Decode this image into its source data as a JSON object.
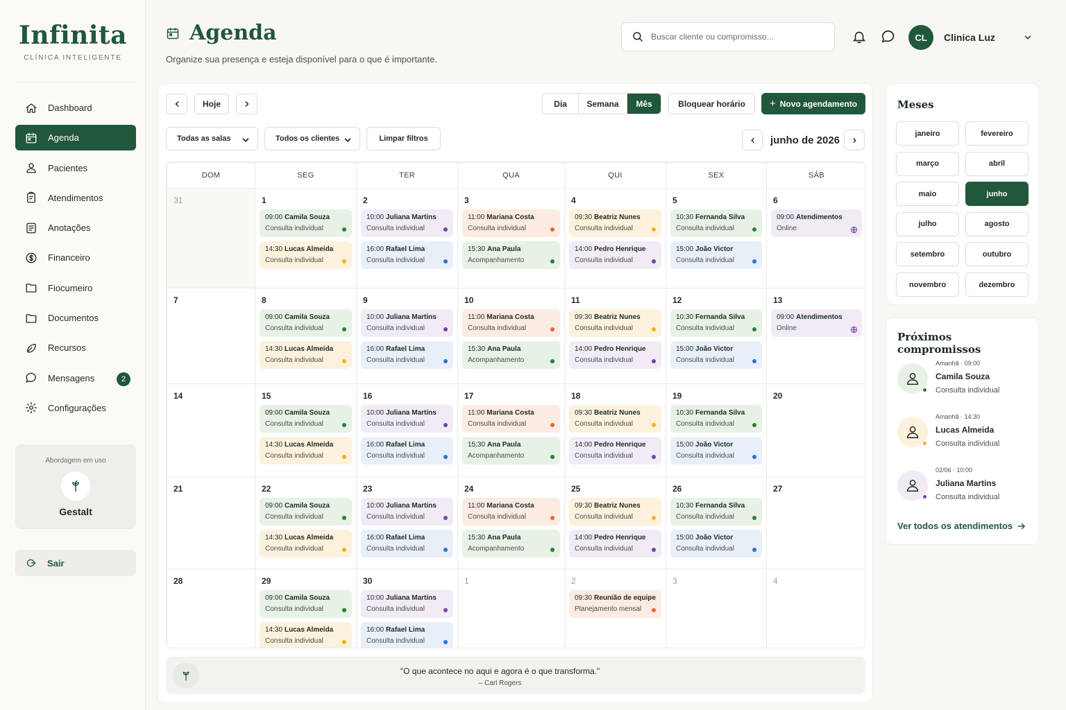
{
  "brand": {
    "name": "Infinita",
    "tagline": "CLÍNICA INTELIGENTE"
  },
  "nav": [
    {
      "label": "Dashboard",
      "icon": "home-icon",
      "active": false
    },
    {
      "label": "Agenda",
      "icon": "calendar-icon",
      "active": true
    },
    {
      "label": "Pacientes",
      "icon": "user-icon",
      "active": false
    },
    {
      "label": "Atendimentos",
      "icon": "clipboard-icon",
      "active": false
    },
    {
      "label": "Anotações",
      "icon": "notes-icon",
      "active": false
    },
    {
      "label": "Financeiro",
      "icon": "dollar-icon",
      "active": false
    },
    {
      "label": "Fiocumeiro",
      "icon": "folder-icon",
      "active": false
    },
    {
      "label": "Documentos",
      "icon": "folder-icon",
      "active": false
    },
    {
      "label": "Recursos",
      "icon": "leaf-icon",
      "active": false
    },
    {
      "label": "Mensagens",
      "icon": "chat-icon",
      "active": false,
      "badge": "2"
    },
    {
      "label": "Configurações",
      "icon": "gear-icon",
      "active": false
    }
  ],
  "approach": {
    "label": "Abordagem em uso",
    "name": "Gestalt",
    "icon": "sprout-icon"
  },
  "logout": {
    "label": "Sair",
    "icon": "logout-icon"
  },
  "header": {
    "title": "Agenda",
    "subtitle": "Organize sua presença e esteja disponível para o que é importante.",
    "search_placeholder": "Buscar cliente ou compromisso...",
    "user_initials": "CL",
    "user_name": "Clinica Luz"
  },
  "toolbar": {
    "today": "Hoje",
    "views": [
      {
        "label": "Dia",
        "active": false
      },
      {
        "label": "Semana",
        "active": false
      },
      {
        "label": "Mês",
        "active": true
      }
    ],
    "block": "Bloquear horário",
    "new": "Novo agendamento",
    "rooms_filter": "Todas as salas",
    "clients_filter": "Todos os clientes",
    "clear": "Limpar filtros",
    "month": "junho de 2026"
  },
  "colors": {
    "primary": "#21573a",
    "green": "#2e7d32",
    "purple": "#7b3fa0",
    "orange": "#e8662a",
    "yellow": "#f2b01e",
    "blue": "#2f6fd6"
  },
  "calendar": {
    "weekdays": [
      "DOM",
      "SEG",
      "TER",
      "QUA",
      "QUI",
      "SEX",
      "SÁB"
    ],
    "weeks": [
      [
        {
          "day": "31",
          "dim": true,
          "events": []
        },
        {
          "day": "1",
          "events": [
            {
              "time": "09:00",
              "name": "Camila Souza",
              "desc": "Consulta individual",
              "color": "green"
            },
            {
              "time": "14:30",
              "name": "Lucas Almeida",
              "desc": "Consulta individual",
              "color": "yellow"
            }
          ]
        },
        {
          "day": "2",
          "events": [
            {
              "time": "10:00",
              "name": "Juliana Martins",
              "desc": "Consulta individual",
              "color": "purple"
            },
            {
              "time": "16:00",
              "name": "Rafael Lima",
              "desc": "Consulta individual",
              "color": "blue"
            }
          ]
        },
        {
          "day": "3",
          "events": [
            {
              "time": "11:00",
              "name": "Mariana Costa",
              "desc": "Consulta individual",
              "color": "peach"
            },
            {
              "time": "15:30",
              "name": "Ana Paula",
              "desc": "Acompanhamento",
              "color": "green"
            }
          ]
        },
        {
          "day": "4",
          "events": [
            {
              "time": "09:30",
              "name": "Beatriz Nunes",
              "desc": "Consulta individual",
              "color": "yellow"
            },
            {
              "time": "14:00",
              "name": "Pedro Henrique",
              "desc": "Consulta individual",
              "color": "purple"
            }
          ]
        },
        {
          "day": "5",
          "events": [
            {
              "time": "10:30",
              "name": "Fernanda Silva",
              "desc": "Consulta individual",
              "color": "green"
            },
            {
              "time": "15:00",
              "name": "João Victor",
              "desc": "Consulta individual",
              "color": "blue"
            }
          ]
        },
        {
          "day": "6",
          "events": [
            {
              "time": "09:00",
              "name": "Atendimentos",
              "desc": "Online",
              "color": "purple",
              "globe": true
            }
          ]
        }
      ],
      [
        {
          "day": "7",
          "events": []
        },
        {
          "day": "8",
          "events": [
            {
              "time": "09:00",
              "name": "Camila Souza",
              "desc": "Consulta individual",
              "color": "green"
            },
            {
              "time": "14:30",
              "name": "Lucas Almeida",
              "desc": "Consulta individual",
              "color": "yellow"
            }
          ]
        },
        {
          "day": "9",
          "events": [
            {
              "time": "10:00",
              "name": "Juliana Martins",
              "desc": "Consulta individual",
              "color": "purple"
            },
            {
              "time": "16:00",
              "name": "Rafael Lima",
              "desc": "Consulta individual",
              "color": "blue"
            }
          ]
        },
        {
          "day": "10",
          "events": [
            {
              "time": "11:00",
              "name": "Mariana Costa",
              "desc": "Consulta individual",
              "color": "peach"
            },
            {
              "time": "15:30",
              "name": "Ana Paula",
              "desc": "Acompanhamento",
              "color": "green"
            }
          ]
        },
        {
          "day": "11",
          "events": [
            {
              "time": "09:30",
              "name": "Beatriz Nunes",
              "desc": "Consulta individual",
              "color": "yellow"
            },
            {
              "time": "14:00",
              "name": "Pedro Henrique",
              "desc": "Consulta individual",
              "color": "purple"
            }
          ]
        },
        {
          "day": "12",
          "events": [
            {
              "time": "10:30",
              "name": "Fernanda Silva",
              "desc": "Consulta individual",
              "color": "green"
            },
            {
              "time": "15:00",
              "name": "João Victor",
              "desc": "Consulta individual",
              "color": "blue"
            }
          ]
        },
        {
          "day": "13",
          "events": [
            {
              "time": "09:00",
              "name": "Atendimentos",
              "desc": "Online",
              "color": "purple",
              "globe": true
            }
          ]
        }
      ],
      [
        {
          "day": "14",
          "events": []
        },
        {
          "day": "15",
          "events": [
            {
              "time": "09:00",
              "name": "Camila Souza",
              "desc": "Consulta individual",
              "color": "green"
            },
            {
              "time": "14:30",
              "name": "Lucas Almeida",
              "desc": "Consulta individual",
              "color": "yellow"
            }
          ]
        },
        {
          "day": "16",
          "events": [
            {
              "time": "10:00",
              "name": "Juliana Martins",
              "desc": "Consulta individual",
              "color": "purple"
            },
            {
              "time": "16:00",
              "name": "Rafael Lima",
              "desc": "Consulta individual",
              "color": "blue"
            }
          ]
        },
        {
          "day": "17",
          "events": [
            {
              "time": "11:00",
              "name": "Mariana Costa",
              "desc": "Consulta individual",
              "color": "peach"
            },
            {
              "time": "15:30",
              "name": "Ana Paula",
              "desc": "Acompanhamento",
              "color": "green"
            }
          ]
        },
        {
          "day": "18",
          "events": [
            {
              "time": "09:30",
              "name": "Beatriz Nunes",
              "desc": "Consulta individual",
              "color": "yellow"
            },
            {
              "time": "14:00",
              "name": "Pedro Henrique",
              "desc": "Consulta individual",
              "color": "purple"
            }
          ]
        },
        {
          "day": "19",
          "events": [
            {
              "time": "10:30",
              "name": "Fernanda Silva",
              "desc": "Consulta individual",
              "color": "green"
            },
            {
              "time": "15:00",
              "name": "João Victor",
              "desc": "Consulta individual",
              "color": "blue"
            }
          ]
        },
        {
          "day": "20",
          "events": []
        }
      ],
      [
        {
          "day": "21",
          "events": []
        },
        {
          "day": "22",
          "events": [
            {
              "time": "09:00",
              "name": "Camila Souza",
              "desc": "Consulta individual",
              "color": "green"
            },
            {
              "time": "14:30",
              "name": "Lucas Almeida",
              "desc": "Consulta individual",
              "color": "yellow"
            }
          ]
        },
        {
          "day": "23",
          "events": [
            {
              "time": "10:00",
              "name": "Juliana Martins",
              "desc": "Consulta individual",
              "color": "purple"
            },
            {
              "time": "16:00",
              "name": "Rafael Lima",
              "desc": "Consulta individual",
              "color": "blue"
            }
          ]
        },
        {
          "day": "24",
          "events": [
            {
              "time": "11:00",
              "name": "Mariana Costa",
              "desc": "Consulta individual",
              "color": "peach"
            },
            {
              "time": "15:30",
              "name": "Ana Paula",
              "desc": "Acompanhamento",
              "color": "green"
            }
          ]
        },
        {
          "day": "25",
          "events": [
            {
              "time": "09:30",
              "name": "Beatriz Nunes",
              "desc": "Consulta individual",
              "color": "yellow"
            },
            {
              "time": "14:00",
              "name": "Pedro Henrique",
              "desc": "Consulta individual",
              "color": "purple"
            }
          ]
        },
        {
          "day": "26",
          "events": [
            {
              "time": "10:30",
              "name": "Fernanda Silva",
              "desc": "Consulta individual",
              "color": "green"
            },
            {
              "time": "15:00",
              "name": "João Victor",
              "desc": "Consulta individual",
              "color": "blue"
            }
          ]
        },
        {
          "day": "27",
          "events": []
        }
      ],
      [
        {
          "day": "28",
          "events": []
        },
        {
          "day": "29",
          "events": [
            {
              "time": "09:00",
              "name": "Camila Souza",
              "desc": "Consulta individual",
              "color": "green"
            },
            {
              "time": "14:30",
              "name": "Lucas Almeida",
              "desc": "Consulta individual",
              "color": "yellow"
            }
          ]
        },
        {
          "day": "30",
          "events": [
            {
              "time": "10:00",
              "name": "Juliana Martins",
              "desc": "Consulta individual",
              "color": "purple"
            },
            {
              "time": "16:00",
              "name": "Rafael Lima",
              "desc": "Consulta individual",
              "color": "blue"
            }
          ]
        },
        {
          "day": "1",
          "dim": true,
          "events": []
        },
        {
          "day": "2",
          "dim": true,
          "events": [
            {
              "time": "09:30",
              "name": "Reunião de equipe",
              "desc": "Planejamento mensal",
              "color": "peach"
            }
          ]
        },
        {
          "day": "3",
          "dim": true,
          "events": []
        },
        {
          "day": "4",
          "dim": true,
          "events": []
        }
      ]
    ]
  },
  "quote": {
    "text": "\"O que acontece no aqui e agora é o que transforma.\"",
    "author": "– Carl Rogers"
  },
  "months_panel": {
    "title": "Meses",
    "months": [
      {
        "label": "janeiro"
      },
      {
        "label": "fevereiro"
      },
      {
        "label": "março"
      },
      {
        "label": "abril"
      },
      {
        "label": "maio"
      },
      {
        "label": "junho",
        "active": true
      },
      {
        "label": "julho"
      },
      {
        "label": "agosto"
      },
      {
        "label": "setembro"
      },
      {
        "label": "outubro"
      },
      {
        "label": "novembro"
      },
      {
        "label": "dezembro"
      }
    ]
  },
  "upcoming": {
    "title": "Próximos compromissos",
    "items": [
      {
        "when": "Amanhã · 09:00",
        "name": "Camila Souza",
        "desc": "Consulta individual",
        "color": "green"
      },
      {
        "when": "Amanhã · 14:30",
        "name": "Lucas Almeida",
        "desc": "Consulta individual",
        "color": "yellow"
      },
      {
        "when": "02/06 · 10:00",
        "name": "Juliana Martins",
        "desc": "Consulta individual",
        "color": "purple"
      }
    ],
    "see_all": "Ver todos os atendimentos"
  }
}
